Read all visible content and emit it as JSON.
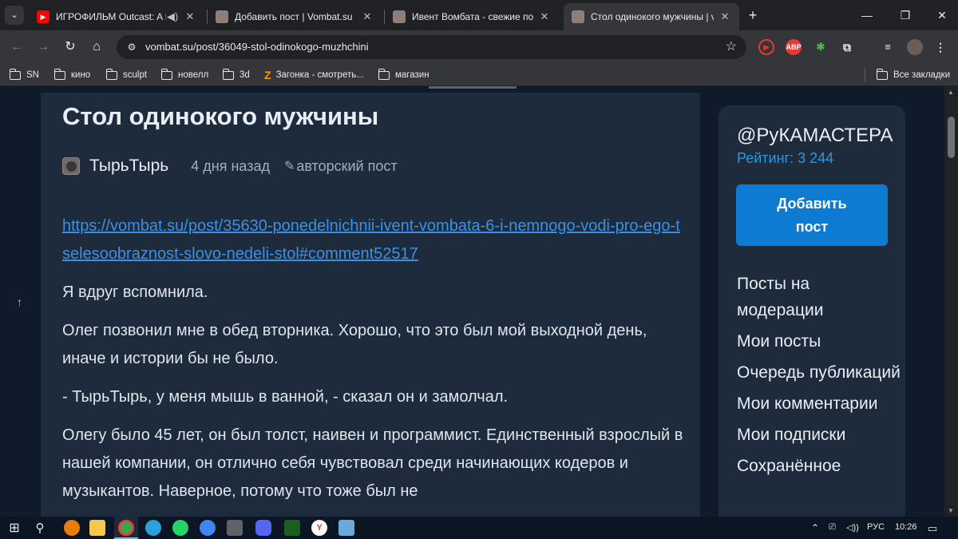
{
  "browser": {
    "tabs": [
      {
        "title": "ИГРОФИЛЬМ Outcast: A N",
        "favicon": "youtube-icon",
        "audio": true
      },
      {
        "title": "Добавить пост | Vombat.su",
        "favicon": "vombat-icon"
      },
      {
        "title": "Ивент Вомбата - свежие пост",
        "favicon": "vombat-icon"
      },
      {
        "title": "Стол одинокого мужчины | vo",
        "favicon": "vombat-icon",
        "active": true
      }
    ],
    "url": "vombat.su/post/36049-stol-odinokogo-muzhchini",
    "bookmarks": [
      {
        "label": "SN",
        "icon": "folder-icon"
      },
      {
        "label": "кино",
        "icon": "folder-icon"
      },
      {
        "label": "sculpt",
        "icon": "folder-icon"
      },
      {
        "label": "новелл",
        "icon": "folder-icon"
      },
      {
        "label": "3d",
        "icon": "folder-icon"
      },
      {
        "label": "Загонка - смотреть...",
        "icon": "zagonka-icon"
      },
      {
        "label": "магазин",
        "icon": "folder-icon"
      }
    ],
    "all_bookmarks_label": "Все закладки",
    "abp_label": "ABP"
  },
  "post": {
    "title": "Стол одинокого мужчины",
    "author": "ТырьТырь",
    "date": "4 дня назад",
    "kind": "авторский пост",
    "link": "https://vombat.su/post/35630-ponedelnichnii-ivent-vombata-6-i-nemnogo-vodi-pro-ego-tselesoobraznost-slovo-nedeli-stol#comment52517",
    "paragraphs": [
      "Я вдруг вспомнила.",
      "Олег позвонил мне в обед вторника. Хорошо, что это был мой выходной день, иначе и истории бы не было.",
      "- ТырьТырь, у меня мышь в ванной, - сказал он и замолчал.",
      "Олегу было 45 лет, он был толст, наивен и программист. Единственный взрослый в нашей компании, он отлично себя чувствовал среди начинающих кодеров и музыкантов. Наверное, потому что тоже был не"
    ]
  },
  "sidebar": {
    "handle": "@РуКАМАСТЕРА",
    "rating": "Рейтинг: 3 244",
    "add_post": "Добавить пост",
    "menu": [
      "Посты на модерации",
      "Мои посты",
      "Очередь публикаций",
      "Мои комментарии",
      "Мои подписки",
      "Сохранённое"
    ]
  },
  "taskbar": {
    "language": "РУС",
    "time": "10:26"
  },
  "colors": {
    "page_bg": "#0f1a2b",
    "card_bg": "#1e2b3c",
    "link": "#3d8fe3",
    "accent_button": "#0d7bd2",
    "rating": "#2f96de"
  }
}
